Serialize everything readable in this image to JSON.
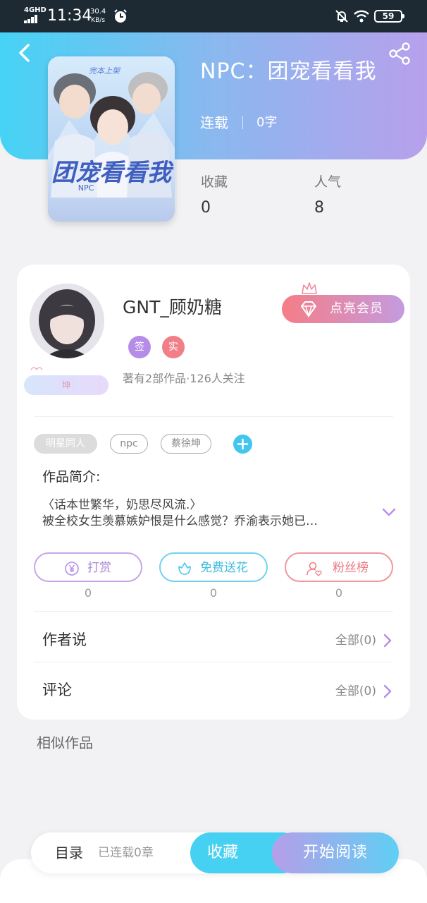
{
  "status_bar": {
    "network": "4GHD",
    "time": "11:34",
    "speed_value": "30.4",
    "speed_unit": "KB/s",
    "battery": "59"
  },
  "book": {
    "title": "NPC：团宠看看我",
    "status": "连载",
    "word_count": "0字",
    "cover_text_top": "完本上架",
    "cover_text_title": "团宠看看我",
    "cover_text_sub": "NPC",
    "stats": [
      {
        "label": "收藏",
        "value": "0"
      },
      {
        "label": "人气",
        "value": "8"
      }
    ]
  },
  "author": {
    "name": "GNT_顾奶糖",
    "badges": [
      {
        "text": "签",
        "color": "#b58de8"
      },
      {
        "text": "实",
        "color": "#f07f88"
      }
    ],
    "stats_text": "著有2部作品·126人关注",
    "fan_badge": "坤",
    "vip_button": "点亮会员"
  },
  "tags": [
    "明星同人",
    "npc",
    "蔡徐坤"
  ],
  "intro": {
    "label": "作品简介:",
    "line1": "〈话本世繁华，奶思尽风流.〉",
    "line2": "被全校女生羡慕嫉妒恨是什么感觉？乔渝表示她已…"
  },
  "actions": [
    {
      "label": "打赏",
      "count": "0",
      "color": "#b58de8",
      "icon": "yen-icon"
    },
    {
      "label": "免费送花",
      "count": "0",
      "color": "#46c8ea",
      "icon": "flower-icon"
    },
    {
      "label": "粉丝榜",
      "count": "0",
      "color": "#f07f88",
      "icon": "fan-rank-icon"
    }
  ],
  "rows": [
    {
      "label": "作者说",
      "value": "全部(0)"
    },
    {
      "label": "评论",
      "value": "全部(0)"
    }
  ],
  "similar_title": "相似作品",
  "bottom_bar": {
    "toc": "目录",
    "chapters": "已连载0章",
    "collect": "收藏",
    "read": "开始阅读"
  },
  "colors": {
    "accent_cyan": "#46d1f2",
    "accent_purple": "#b69ee9",
    "accent_pink": "#f07f88"
  }
}
